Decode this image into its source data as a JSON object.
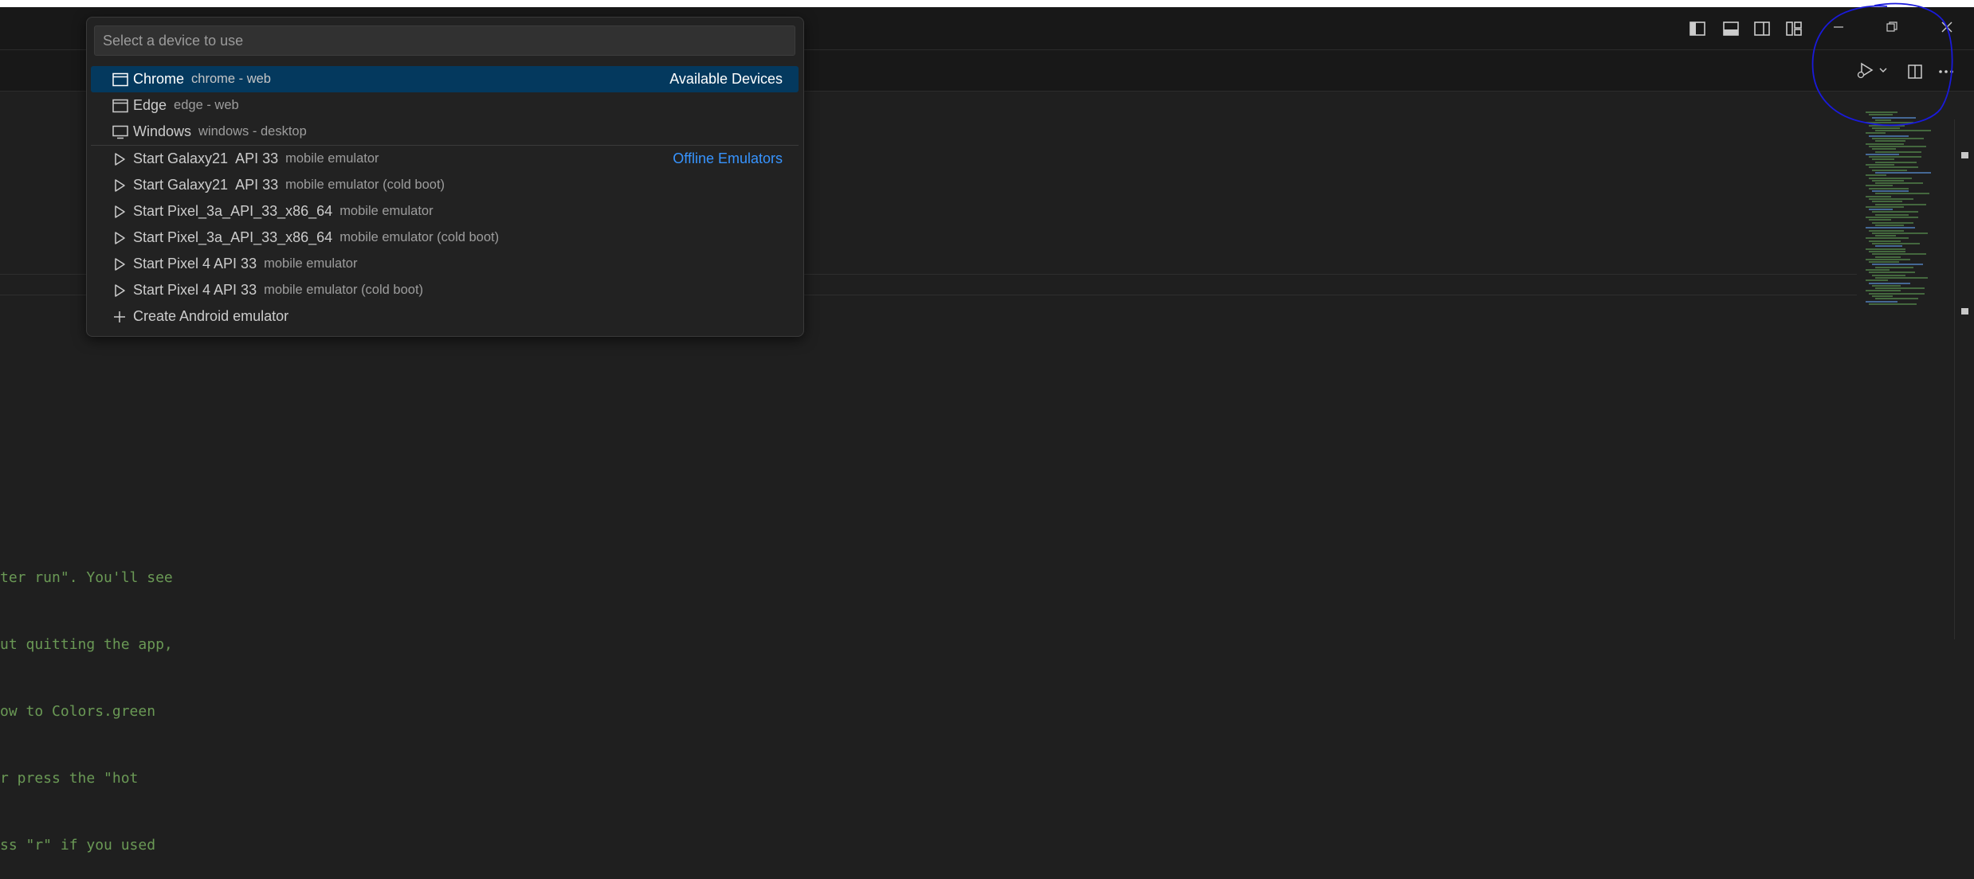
{
  "quick_pick": {
    "placeholder": "Select a device to use",
    "items": [
      {
        "icon": "browser-window-icon",
        "label": "Chrome",
        "description": "chrome - web",
        "group": "Available Devices",
        "selected": true
      },
      {
        "icon": "browser-window-icon",
        "label": "Edge",
        "description": "edge - web",
        "group": "",
        "selected": false
      },
      {
        "icon": "desktop-monitor-icon",
        "label": "Windows",
        "description": "windows - desktop",
        "group": "",
        "selected": false
      },
      {
        "icon": "play-icon",
        "label": "Start Galaxy21  API 33",
        "description": "mobile emulator",
        "group": "Offline Emulators",
        "selected": false
      },
      {
        "icon": "play-icon",
        "label": "Start Galaxy21  API 33",
        "description": "mobile emulator (cold boot)",
        "group": "",
        "selected": false
      },
      {
        "icon": "play-icon",
        "label": "Start Pixel_3a_API_33_x86_64",
        "description": "mobile emulator",
        "group": "",
        "selected": false
      },
      {
        "icon": "play-icon",
        "label": "Start Pixel_3a_API_33_x86_64",
        "description": "mobile emulator (cold boot)",
        "group": "",
        "selected": false
      },
      {
        "icon": "play-icon",
        "label": "Start Pixel 4 API 33",
        "description": "mobile emulator",
        "group": "",
        "selected": false
      },
      {
        "icon": "play-icon",
        "label": "Start Pixel 4 API 33",
        "description": "mobile emulator (cold boot)",
        "group": "",
        "selected": false
      },
      {
        "icon": "plus-icon",
        "label": "Create Android emulator",
        "description": "",
        "group": "",
        "selected": false
      }
    ]
  },
  "editor": {
    "code_lines": [
      "ter run\". You'll see",
      "ut quitting the app,",
      "ow to Colors.green",
      "r press the \"hot",
      "ss \"r\" if you used"
    ]
  },
  "title_bar": {
    "layout_icons": [
      "toggle-primary-sidebar-icon",
      "toggle-panel-icon",
      "toggle-secondary-sidebar-icon",
      "customize-layout-icon"
    ],
    "window_controls": [
      "minimize-icon",
      "restore-icon",
      "close-icon"
    ]
  },
  "editor_actions": [
    "run-debug-icon",
    "split-editor-icon",
    "more-actions-icon"
  ],
  "colors": {
    "selection": "#04395e",
    "group_label_link": "#3794ff",
    "comment_green": "#6a9955",
    "annotation_ink": "#1a1adb"
  }
}
